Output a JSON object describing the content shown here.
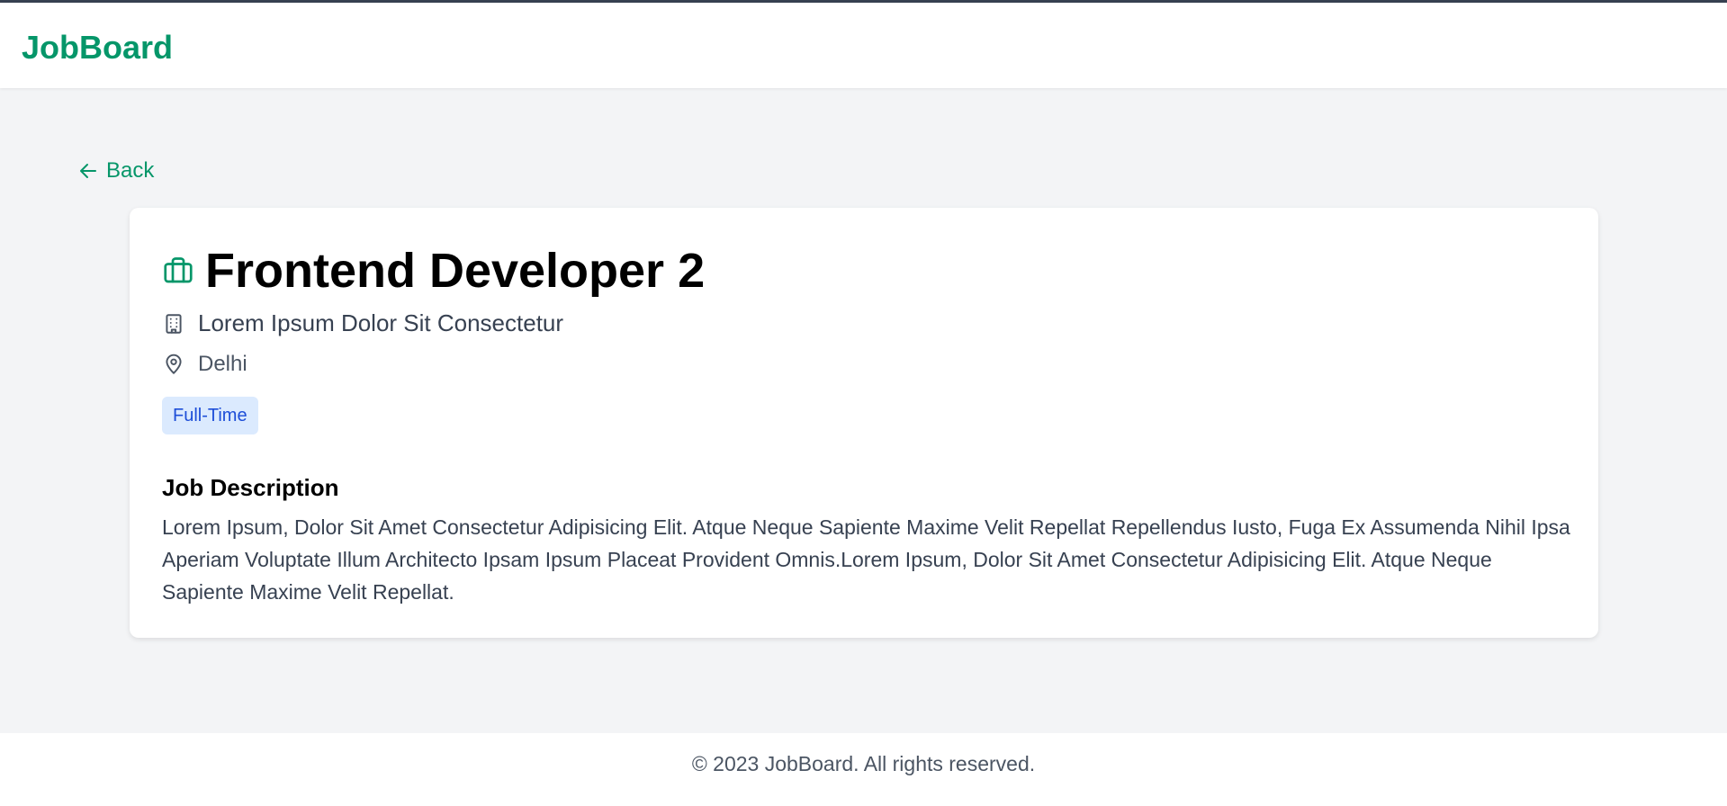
{
  "header": {
    "brand": "JobBoard"
  },
  "nav": {
    "back_label": "Back"
  },
  "job": {
    "title": "Frontend Developer 2",
    "company": "Lorem Ipsum Dolor Sit Consectetur",
    "location": "Delhi",
    "type": "Full-Time",
    "description_heading": "Job Description",
    "description": "Lorem Ipsum, Dolor Sit Amet Consectetur Adipisicing Elit. Atque Neque Sapiente Maxime Velit Repellat Repellendus Iusto, Fuga Ex Assumenda Nihil Ipsa Aperiam Voluptate Illum Architecto Ipsam Ipsum Placeat Provident Omnis.Lorem Ipsum, Dolor Sit Amet Consectetur Adipisicing Elit. Atque Neque Sapiente Maxime Velit Repellat."
  },
  "footer": {
    "text": "© 2023 JobBoard. All rights reserved."
  },
  "icons": {
    "back": "arrow-left-icon",
    "job": "briefcase-icon",
    "company": "building-icon",
    "location": "map-pin-icon"
  },
  "colors": {
    "brand": "#059669",
    "badge_bg": "#dbeafe",
    "badge_text": "#1d4ed8",
    "page_bg": "#f3f4f6"
  }
}
